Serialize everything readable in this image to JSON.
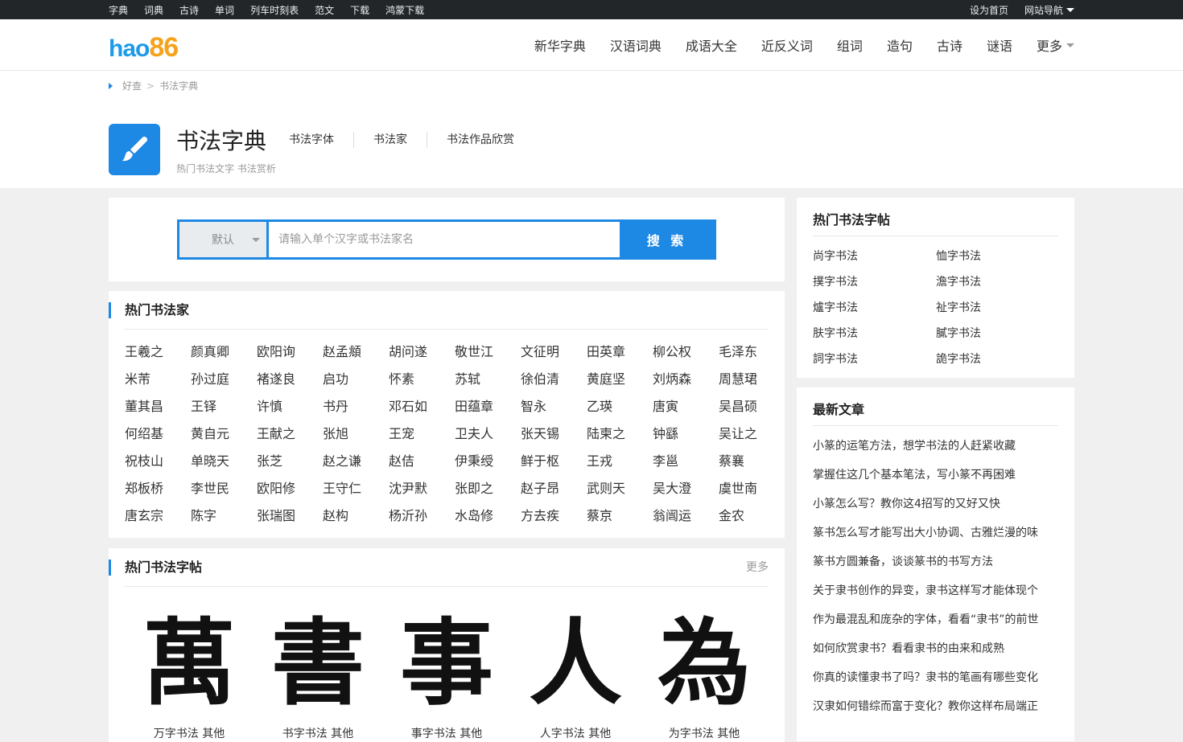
{
  "topbar": {
    "links": [
      "字典",
      "词典",
      "古诗",
      "单词",
      "列车时刻表",
      "范文",
      "下载",
      "鸿蒙下载"
    ],
    "set_home": "设为首页",
    "site_nav": "网站导航"
  },
  "header": {
    "logo_text": "hao",
    "logo_num": "86",
    "nav": [
      "新华字典",
      "汉语词典",
      "成语大全",
      "近反义词",
      "组词",
      "造句",
      "古诗",
      "谜语"
    ],
    "more": "更多"
  },
  "breadcrumb": {
    "home": "好查",
    "sep": ">",
    "current": "书法字典"
  },
  "brand": {
    "title": "书法字典",
    "subtitle": "热门书法文字 书法赏析",
    "links": [
      "书法字体",
      "书法家",
      "书法作品欣赏"
    ]
  },
  "search": {
    "select_value": "默认",
    "placeholder": "请输入单个汉字或书法家名",
    "button": "搜 索"
  },
  "artists": {
    "title": "热门书法家",
    "names": [
      "王羲之",
      "颜真卿",
      "欧阳询",
      "赵孟頫",
      "胡问遂",
      "敬世江",
      "文征明",
      "田英章",
      "柳公权",
      "毛泽东",
      "米芾",
      "孙过庭",
      "褚遂良",
      "启功",
      "怀素",
      "苏轼",
      "徐伯清",
      "黄庭坚",
      "刘炳森",
      "周慧珺",
      "董其昌",
      "王铎",
      "许慎",
      "书丹",
      "邓石如",
      "田蕴章",
      "智永",
      "乙瑛",
      "唐寅",
      "吴昌硕",
      "何绍基",
      "黄自元",
      "王献之",
      "张旭",
      "王宠",
      "卫夫人",
      "张天锡",
      "陆柬之",
      "钟繇",
      "吴让之",
      "祝枝山",
      "单晓天",
      "张芝",
      "赵之谦",
      "赵佶",
      "伊秉绶",
      "鲜于枢",
      "王戎",
      "李邕",
      "蔡襄",
      "郑板桥",
      "李世民",
      "欧阳修",
      "王守仁",
      "沈尹默",
      "张即之",
      "赵子昂",
      "武则天",
      "吴大澄",
      "虞世南",
      "唐玄宗",
      "陈字",
      "张瑞图",
      "赵构",
      "杨沂孙",
      "水岛修",
      "方去疾",
      "蔡京",
      "翁闿运",
      "金农"
    ]
  },
  "tie": {
    "title": "热门书法字帖",
    "more": "更多",
    "items": [
      {
        "glyph": "萬",
        "caption": "万字书法 其他"
      },
      {
        "glyph": "書",
        "caption": "书字书法 其他"
      },
      {
        "glyph": "事",
        "caption": "事字书法 其他"
      },
      {
        "glyph": "人",
        "caption": "人字书法 其他"
      },
      {
        "glyph": "為",
        "caption": "为字书法 其他"
      }
    ]
  },
  "side_hot": {
    "title": "热门书法字帖",
    "items": [
      "尚字书法",
      "恤字书法",
      "撲字书法",
      "澹字书法",
      "爐字书法",
      "祉字书法",
      "肤字书法",
      "膩字书法",
      "詞字书法",
      "詭字书法"
    ]
  },
  "side_news": {
    "title": "最新文章",
    "items": [
      "小篆的运笔方法，想学书法的人赶紧收藏",
      "掌握住这几个基本笔法，写小篆不再困难",
      "小篆怎么写？教你这4招写的又好又快",
      "篆书怎么写才能写出大小协调、古雅烂漫的味",
      "篆书方圆兼备，谈谈篆书的书写方法",
      "关于隶书创作的异变，隶书这样写才能体现个",
      "作为最混乱和庞杂的字体，看看“隶书”的前世",
      "如何欣赏隶书？看看隶书的由来和成熟",
      "你真的读懂隶书了吗？隶书的笔画有哪些变化",
      "汉隶如何错综而富于变化？教你这样布局端正"
    ]
  },
  "colors": {
    "accent": "#1e88e5",
    "logo_blue": "#1d9be8",
    "logo_orange": "#f6a21b",
    "topbar_bg": "#222629"
  }
}
